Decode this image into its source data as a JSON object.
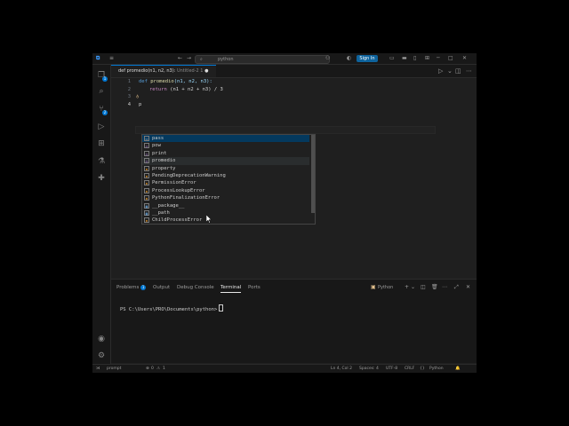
{
  "titlebar": {
    "search_text": "python",
    "sign_in": "Sign In"
  },
  "tab": {
    "label": "def promedio(n1, n2, n3):",
    "detail": "Untitled-2 1"
  },
  "editor": {
    "line_numbers": [
      "1",
      "2",
      "3",
      "4"
    ],
    "line1": {
      "kw": "def",
      "fn": "promedio",
      "args": "(n1, n2, n3):"
    },
    "line2": {
      "kw": "return",
      "expr": "(n1 + n2 + n3) / 3"
    },
    "line4": "p"
  },
  "suggestions": [
    "pass",
    "pow",
    "print",
    "promedio",
    "property",
    "PendingDeprecationWarning",
    "PermissionError",
    "ProcessLookupError",
    "PythonFinalizationError",
    "__package__",
    "__path",
    "ChildProcessError"
  ],
  "panel": {
    "tabs": {
      "problems": "Problems",
      "problems_count": "1",
      "output": "Output",
      "debug_console": "Debug Console",
      "terminal": "Terminal",
      "ports": "Ports"
    },
    "terminal_name": "Python",
    "prompt": "PS C:\\Users\\PRO\\Documents\\python>"
  },
  "statusbar": {
    "remote": "prompt",
    "errors": "0",
    "warnings": "1",
    "position": "Ln 4, Col 2",
    "spaces": "Spaces: 4",
    "encoding": "UTF-8",
    "eol": "CRLF",
    "language": "Python"
  },
  "icons": {
    "accent": "#0078d4",
    "sign_in_bg": "#0e639c"
  }
}
